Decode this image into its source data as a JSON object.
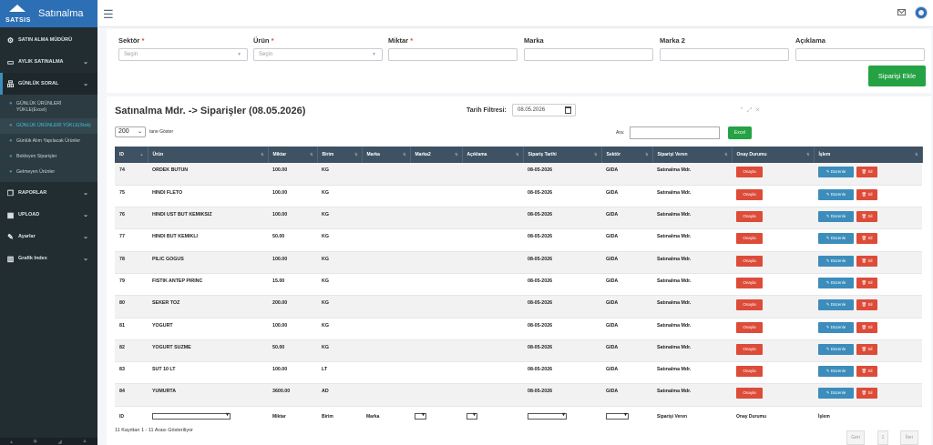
{
  "brand": {
    "logo_text": "SATSIS",
    "title": "Satınalma"
  },
  "sidebar": {
    "items": [
      {
        "label": "SATIN ALMA MÜDÜRÜ",
        "icon": "gear-icon",
        "chevron": false
      },
      {
        "label": "AYLIK SATINALMA",
        "icon": "monitor-icon",
        "chevron": true
      },
      {
        "label": "GÜNLÜK SORAL",
        "icon": "sitemap-icon",
        "chevron": true
      }
    ],
    "submenu": [
      {
        "label": "GÜNLÜK ÜRÜNLERİ YÜKLE(Excel)"
      },
      {
        "label": "GÜNLÜK ÜRÜNLERİ YÜKLE(Stok)"
      },
      {
        "label": "Günlük Alım Yapılacak Ürünler"
      },
      {
        "label": "Bekleyen Siparişler"
      },
      {
        "label": "Gelmeyen Ürünler"
      }
    ],
    "items2": [
      {
        "label": "RAPORLAR",
        "icon": "copy-icon"
      },
      {
        "label": "UPLOAD",
        "icon": "table-icon"
      },
      {
        "label": "Ayarlar",
        "icon": "edit-icon"
      },
      {
        "label": "Grafik Index",
        "icon": "bar-chart-icon"
      }
    ]
  },
  "form": {
    "sektor": {
      "label": "Sektör",
      "placeholder": "Seçin"
    },
    "urun": {
      "label": "Ürün",
      "placeholder": "Seçin"
    },
    "miktar": {
      "label": "Miktar"
    },
    "marka": {
      "label": "Marka"
    },
    "marka2": {
      "label": "Marka 2"
    },
    "aciklama": {
      "label": "Açıklama"
    },
    "required_mark": "*",
    "add_button": "Siparişi Ekle"
  },
  "table_card": {
    "title": "Satınalma Mdr. -> Siparişler (08.05.2026)",
    "filter_label": "Tarih Filtresi:",
    "filter_value": "08.05.2026",
    "page_length": "200",
    "page_length_label": "tane Göster",
    "search_label": "Ara:",
    "excel_label": "Excel",
    "info": "11 Kayıttan 1 - 11 Arası Gösteriliyor",
    "pager": {
      "prev": "Geri",
      "page": "1",
      "next": "İleri"
    }
  },
  "columns": [
    "ID",
    "Ürün",
    "Miktar",
    "Birim",
    "Marka",
    "Marka2",
    "Açıklama",
    "Sipariş Tarihi",
    "Sektör",
    "Siparişi Veren",
    "Onay Durumu",
    "İşlem"
  ],
  "row_actions": {
    "onay": "Onayla",
    "edit": "✎ Düzenle",
    "delete": "🗑 Sil"
  },
  "rows": [
    {
      "id": "74",
      "urun": "ORDEK BUTUN",
      "miktar": "100.00",
      "birim": "KG",
      "tarih": "08-05-2026",
      "sektor": "GIDA",
      "veren": "Satınalma Mdr."
    },
    {
      "id": "75",
      "urun": "HINDI FLETO",
      "miktar": "100.00",
      "birim": "KG",
      "tarih": "08-05-2026",
      "sektor": "GIDA",
      "veren": "Satınalma Mdr."
    },
    {
      "id": "76",
      "urun": "HINDI UST BUT KEMIKSIZ",
      "miktar": "100.00",
      "birim": "KG",
      "tarih": "08-05-2026",
      "sektor": "GIDA",
      "veren": "Satınalma Mdr."
    },
    {
      "id": "77",
      "urun": "HINDI BUT KEMIKLI",
      "miktar": "50.00",
      "birim": "KG",
      "tarih": "08-05-2026",
      "sektor": "GIDA",
      "veren": "Satınalma Mdr."
    },
    {
      "id": "78",
      "urun": "PILIC GOGUS",
      "miktar": "100.00",
      "birim": "KG",
      "tarih": "08-05-2026",
      "sektor": "GIDA",
      "veren": "Satınalma Mdr."
    },
    {
      "id": "79",
      "urun": "FISTIK ANTEP PIRINC",
      "miktar": "15.00",
      "birim": "KG",
      "tarih": "08-05-2026",
      "sektor": "GIDA",
      "veren": "Satınalma Mdr."
    },
    {
      "id": "80",
      "urun": "SEKER TOZ",
      "miktar": "200.00",
      "birim": "KG",
      "tarih": "08-05-2026",
      "sektor": "GIDA",
      "veren": "Satınalma Mdr."
    },
    {
      "id": "81",
      "urun": "YOGURT",
      "miktar": "100.00",
      "birim": "KG",
      "tarih": "08-05-2026",
      "sektor": "GIDA",
      "veren": "Satınalma Mdr."
    },
    {
      "id": "82",
      "urun": "YOGURT SUZME",
      "miktar": "50.00",
      "birim": "KG",
      "tarih": "08-05-2026",
      "sektor": "GIDA",
      "veren": "Satınalma Mdr."
    },
    {
      "id": "83",
      "urun": "SUT 10 LT",
      "miktar": "100.00",
      "birim": "LT",
      "tarih": "08-05-2026",
      "sektor": "GIDA",
      "veren": "Satınalma Mdr."
    },
    {
      "id": "84",
      "urun": "YUMURTA",
      "miktar": "3600.00",
      "birim": "AD",
      "tarih": "08-05-2026",
      "sektor": "GIDA",
      "veren": "Satınalma Mdr."
    }
  ],
  "footer_row": {
    "id": "ID",
    "miktar": "Miktar",
    "birim": "Birim",
    "marka": "Marka",
    "veren": "Siparişi Veren",
    "onay": "Onay Durumu",
    "islem": "İşlem"
  },
  "colors": {
    "brand": "#2c6fb5",
    "sidebar": "#222d32",
    "table_header": "#3e5263",
    "green": "#25a244",
    "blue": "#3c8dbc",
    "red": "#dd4b39"
  }
}
